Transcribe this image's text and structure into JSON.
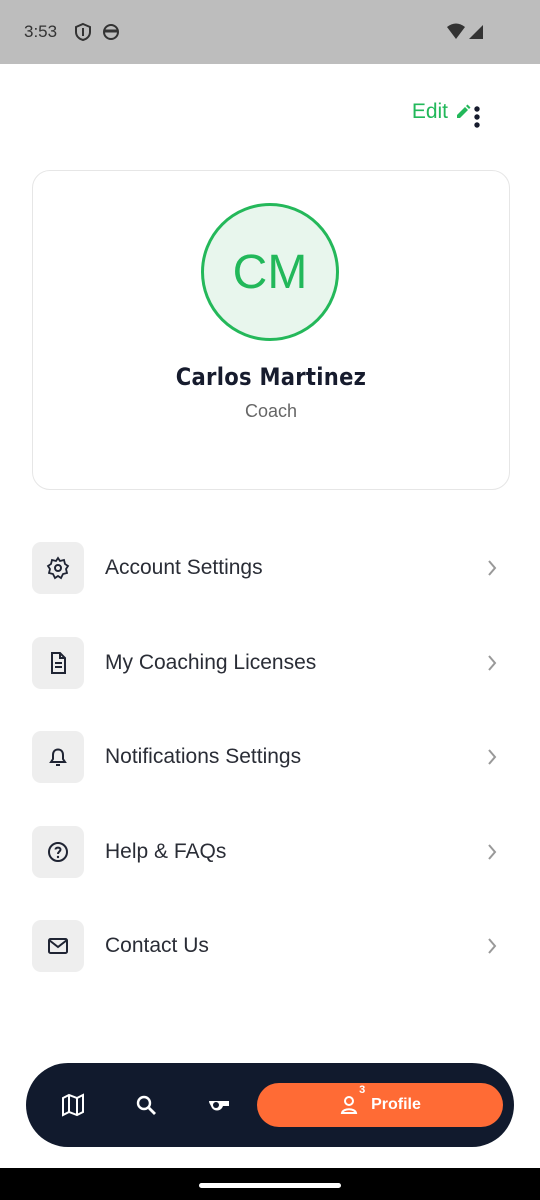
{
  "status": {
    "time": "3:53"
  },
  "header": {
    "edit_label": "Edit"
  },
  "profile": {
    "initials": "CM",
    "name": "Carlos Martinez",
    "role": "Coach"
  },
  "menu": [
    {
      "label": "Account Settings",
      "icon": "gear-icon"
    },
    {
      "label": "My Coaching Licenses",
      "icon": "document-icon"
    },
    {
      "label": "Notifications Settings",
      "icon": "bell-icon"
    },
    {
      "label": "Help & FAQs",
      "icon": "help-icon"
    },
    {
      "label": "Contact Us",
      "icon": "mail-icon"
    }
  ],
  "nav": {
    "active_label": "Profile",
    "badge": "3"
  },
  "colors": {
    "accent": "#22B85A",
    "nav": "#111A2D",
    "active": "#FF6B35"
  }
}
